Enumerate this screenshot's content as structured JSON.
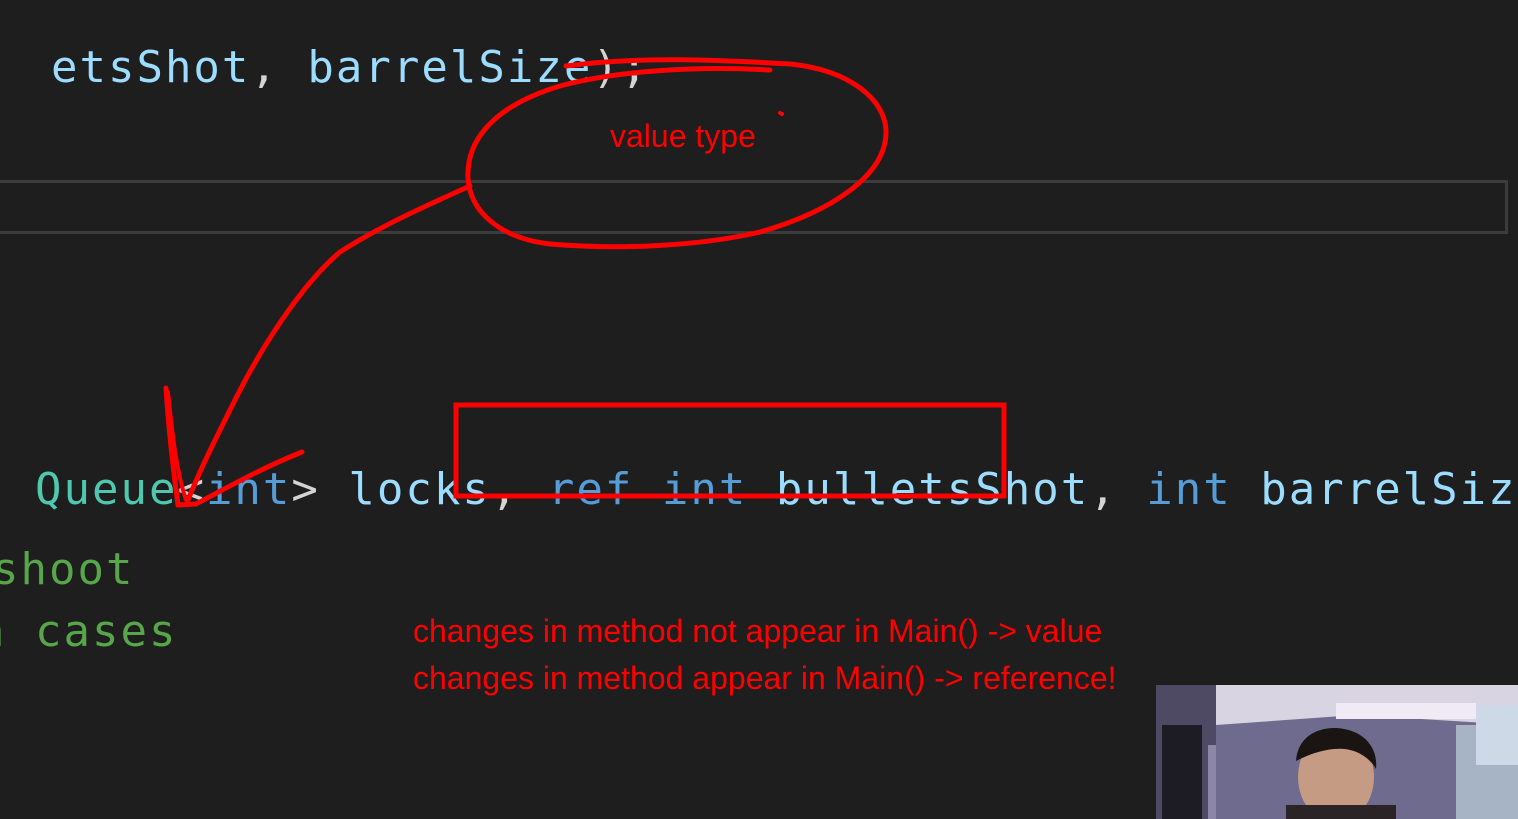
{
  "editor": {
    "line1": {
      "ident1": "etsShot",
      "sep": ",",
      "ident2": "barrelSize",
      "tail": ");"
    },
    "signature": {
      "type_prefix": "Queue",
      "lt": "<",
      "generic_type": "int",
      "gt": ">",
      "param1": "locks",
      "comma1": ",",
      "ref_kw": "ref",
      "int_kw1": "int",
      "param2": "bulletsShot",
      "comma2": ",",
      "int_kw2": "int",
      "param3": "barrelSize",
      "close": ")"
    },
    "comment_line1": "shoot",
    "comment_line2": "n cases"
  },
  "annotations": {
    "bubble_label": "value type",
    "note_line1": "changes in method not appear in Main() -> value",
    "note_line2": "changes in method appear in Main() -> reference!"
  },
  "colors": {
    "background": "#1e1e1e",
    "identifier": "#9cdcfe",
    "keyword": "#569cd6",
    "type": "#4ec9b0",
    "comment": "#57a64a",
    "annotation": "#ff0000"
  }
}
